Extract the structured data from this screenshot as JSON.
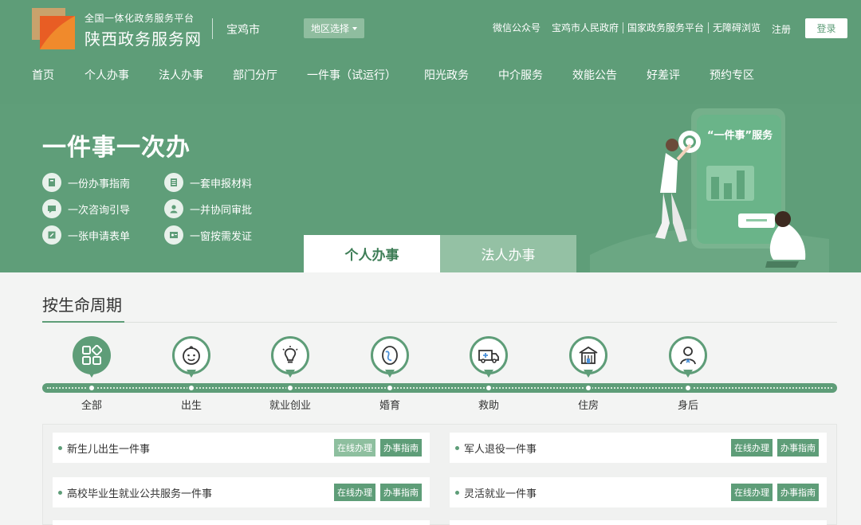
{
  "header": {
    "logo_sub": "全国一体化政务服务平台",
    "logo_main": "陕西政务服务网",
    "city": "宝鸡市",
    "region_select": "地区选择",
    "links": [
      "微信公众号",
      "宝鸡市人民政府",
      "国家政务服务平台",
      "无障碍浏览"
    ],
    "register": "注册",
    "login": "登录"
  },
  "nav": [
    "首页",
    "个人办事",
    "法人办事",
    "部门分厅",
    "一件事（试运行）",
    "阳光政务",
    "中介服务",
    "效能公告",
    "好差评",
    "预约专区"
  ],
  "banner": {
    "title": "一件事一次办",
    "features": [
      "一份办事指南",
      "一套申报材料",
      "一次咨询引导",
      "一并协同审批",
      "一张申请表单",
      "一窗按需发证"
    ],
    "phone_label": "“一件事”服务"
  },
  "tabs": [
    "个人办事",
    "法人办事"
  ],
  "section": {
    "title": "按生命周期",
    "stages": [
      "全部",
      "出生",
      "就业创业",
      "婚育",
      "救助",
      "住房",
      "身后"
    ]
  },
  "items": [
    {
      "name": "新生儿出生一件事",
      "online": "在线办理",
      "guide": "办事指南"
    },
    {
      "name": "军人退役一件事",
      "online": "在线办理",
      "guide": "办事指南"
    },
    {
      "name": "高校毕业生就业公共服务一件事",
      "online": "在线办理",
      "guide": "办事指南"
    },
    {
      "name": "灵活就业一件事",
      "online": "在线办理",
      "guide": "办事指南"
    }
  ],
  "colors": {
    "brand": "#5e9d78",
    "brand_light": "#8ebf9f",
    "background": "#f3f4f3"
  }
}
